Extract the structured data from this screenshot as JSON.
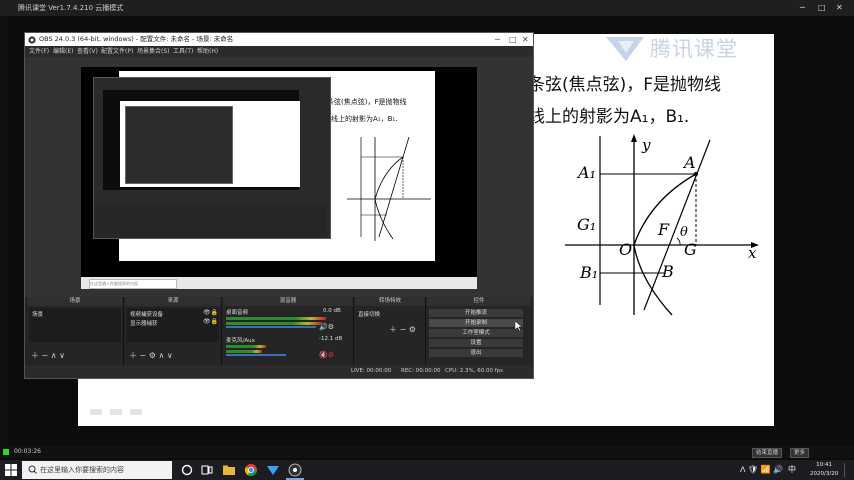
{
  "outer_app": {
    "title": "腾讯课堂 Ver1.7.4.210 云播模式",
    "recording_time": "00:03:26",
    "btn_left": "结束直播",
    "btn_right": "更多"
  },
  "slide": {
    "logo_text": "腾讯课堂",
    "line1": "条弦(焦点弦)，F是抛物线",
    "line2": "线上的射影为A₁，B₁.",
    "graph_labels": {
      "y": "y",
      "x": "x",
      "A": "A",
      "A1": "A₁",
      "G1": "G₁",
      "O": "O",
      "F": "F",
      "theta": "θ",
      "G": "G",
      "B1": "B₁",
      "B": "B"
    }
  },
  "obs": {
    "title": "OBS 24.0.3 (64-bit, windows) - 配置文件: 未命名 - 场景: 未命名",
    "menu": [
      "文件(F)",
      "编辑(E)",
      "查看(V)",
      "配置文件(P)",
      "场景集合(S)",
      "工具(T)",
      "帮助(H)"
    ],
    "inner_slide_line1": "条弦(焦点弦)，F是抛物线",
    "inner_slide_line2": "线上的射影为A₁，B₁.",
    "inner_search": "在这里输入你要搜索的内容",
    "docks": {
      "scenes": {
        "header": "场景",
        "items": [
          "场景"
        ]
      },
      "sources": {
        "header": "来源",
        "items": [
          "视频捕获设备",
          "显示器捕获"
        ]
      },
      "mixer": {
        "header": "混音器",
        "tracks": [
          {
            "name": "桌面音频",
            "db": "0.0 dB"
          },
          {
            "name": "麦克风/Aux",
            "db": "-12.1 dB"
          }
        ]
      },
      "transitions": {
        "header": "转场特效",
        "value": "直接切换"
      },
      "controls": {
        "header": "控件",
        "buttons": [
          "开始推流",
          "开始录制",
          "工作室模式",
          "设置",
          "退出"
        ]
      }
    },
    "status": {
      "live": "LIVE: 00:00:00",
      "rec": "REC: 00:00:00",
      "cpu": "CPU: 2.3%, 60.00 fps"
    }
  },
  "taskbar": {
    "search_placeholder": "在这里输入你要搜索的内容",
    "clock_time": "10:41",
    "clock_date": "2020/3/20",
    "ime": "中"
  }
}
